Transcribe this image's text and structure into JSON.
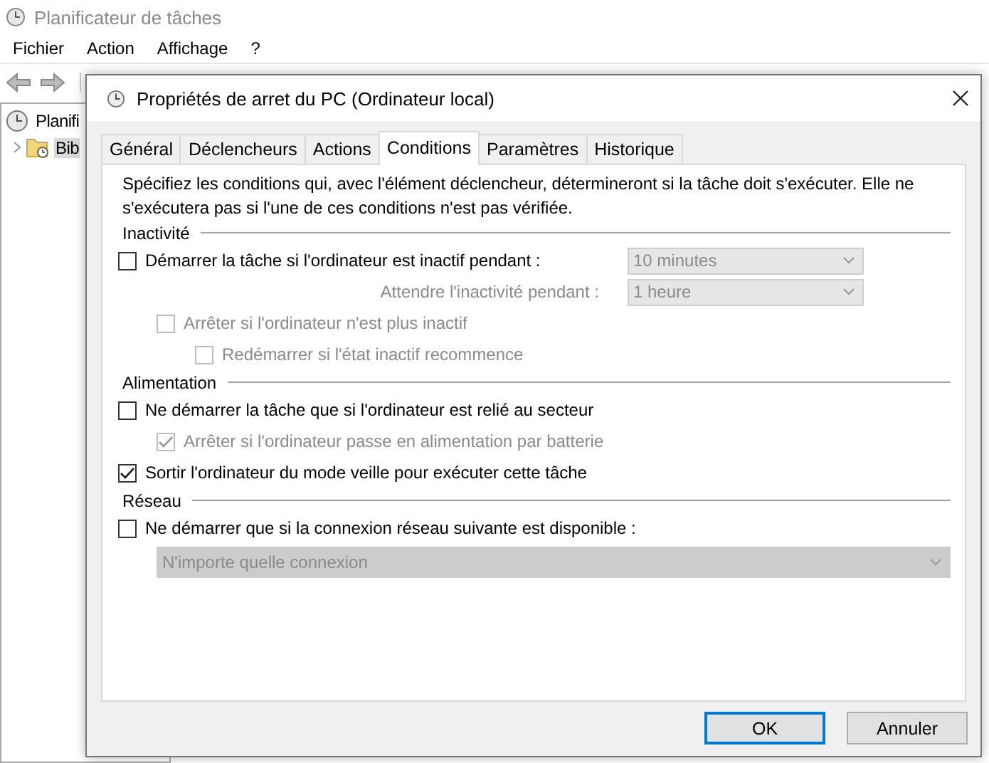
{
  "app": {
    "title": "Planificateur de tâches",
    "menu": [
      "Fichier",
      "Action",
      "Affichage",
      "?"
    ],
    "tree": [
      {
        "label": "Planifi",
        "children": [
          {
            "label": "Bib",
            "selected": true,
            "expanded": false
          }
        ]
      }
    ]
  },
  "dialog": {
    "title": "Propriétés de arret du PC (Ordinateur local)",
    "tabs": [
      {
        "label": "Général",
        "selected": false
      },
      {
        "label": "Déclencheurs",
        "selected": false
      },
      {
        "label": "Actions",
        "selected": false
      },
      {
        "label": "Conditions",
        "selected": true
      },
      {
        "label": "Paramètres",
        "selected": false
      },
      {
        "label": "Historique",
        "selected": false
      }
    ],
    "description": "Spécifiez les conditions qui, avec l'élément déclencheur, détermineront si la tâche doit s'exécuter. Elle ne s'exécutera pas si l'une de ces conditions n'est pas vérifiée.",
    "sections": [
      {
        "heading": "Inactivité",
        "items": [
          {
            "kind": "checkbox",
            "label": "Démarrer la tâche si l'ordinateur est inactif pendant :",
            "checked": false,
            "disabled": false,
            "dropdown": {
              "value": "10 minutes",
              "disabled": true
            },
            "children": [
              {
                "kind": "field",
                "label": "Attendre l'inactivité pendant :",
                "disabled": true,
                "dropdown": {
                  "value": "1 heure",
                  "disabled": true
                }
              },
              {
                "kind": "checkbox",
                "label": "Arrêter si l'ordinateur n'est plus inactif",
                "checked": false,
                "disabled": true,
                "children": [
                  {
                    "kind": "checkbox",
                    "label": "Redémarrer si l'état inactif recommence",
                    "checked": false,
                    "disabled": true
                  }
                ]
              }
            ]
          }
        ]
      },
      {
        "heading": "Alimentation",
        "items": [
          {
            "kind": "checkbox",
            "label": "Ne démarrer la tâche que si l'ordinateur est relié au secteur",
            "checked": false,
            "disabled": false,
            "children": [
              {
                "kind": "checkbox",
                "label": "Arrêter si l'ordinateur passe en alimentation par batterie",
                "checked": true,
                "disabled": true
              }
            ]
          },
          {
            "kind": "checkbox",
            "label": "Sortir l'ordinateur du mode veille pour exécuter cette tâche",
            "checked": true,
            "disabled": false
          }
        ]
      },
      {
        "heading": "Réseau",
        "items": [
          {
            "kind": "checkbox",
            "label": "Ne démarrer que si la connexion réseau suivante est disponible :",
            "checked": false,
            "disabled": false,
            "children": [
              {
                "kind": "dropdown",
                "value": "N'importe quelle connexion",
                "disabled": true
              }
            ]
          }
        ]
      }
    ],
    "buttons": [
      {
        "label": "OK",
        "default": true
      },
      {
        "label": "Annuler",
        "default": false
      }
    ]
  }
}
